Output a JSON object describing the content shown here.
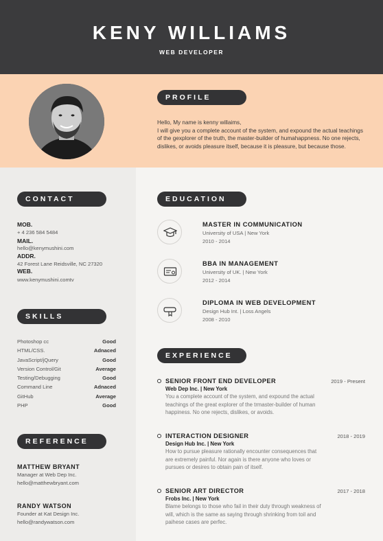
{
  "header": {
    "name": "KENY WILLIAMS",
    "role": "WEB DEVELOPER"
  },
  "profile": {
    "heading": "PROFILE",
    "greeting": "Hello, My name is kenny willaims,",
    "body": "I will give you a complete account of the system, and expound the actual teachings of the gexplorer of the truth, the master-builder of humahappness. No one rejects, dislikes, or avoids pleasure itself, because it is pleasure, but because those."
  },
  "contact": {
    "heading": "CONTACT",
    "mob_label": "MOB.",
    "mob": "+ 4 236 584 5484",
    "mail_label": "MAIL.",
    "mail": "hello@kenymushini.com",
    "addr_label": "ADDR.",
    "addr": "42 Forest Lane Reidsville, NC 27320",
    "web_label": "WEB.",
    "web": "www.kenymushini.comtv"
  },
  "skills": {
    "heading": "SKILLS",
    "items": [
      {
        "name": "Photoshop cc",
        "level": "Good"
      },
      {
        "name": "HTML/CSS.",
        "level": "Adnaced"
      },
      {
        "name": "JavaScript/jQuery",
        "level": "Good"
      },
      {
        "name": "Version Control/Git",
        "level": "Average"
      },
      {
        "name": "Testing/Debugging",
        "level": "Good"
      },
      {
        "name": "Command Line",
        "level": "Adnaced"
      },
      {
        "name": "GitHub",
        "level": "Average"
      },
      {
        "name": "PHP",
        "level": "Good"
      }
    ]
  },
  "reference": {
    "heading": "REFERENCE",
    "items": [
      {
        "name": "MATTHEW BRYANT",
        "title": "Manager at Web Dep Inc.",
        "email": "hello@matthewbryant.com"
      },
      {
        "name": "RANDY WATSON",
        "title": "Founder at Kat Design Inc.",
        "email": "hello@randywatson.com"
      }
    ]
  },
  "education": {
    "heading": "EDUCATION",
    "items": [
      {
        "icon": "graduation-cap-icon",
        "title": "MASTER IN COMMUNICATION",
        "school": "University of USA | New York",
        "years": "2010 - 2014"
      },
      {
        "icon": "certificate-icon",
        "title": "BBA IN MANAGEMENT",
        "school": "University of UK. | New York",
        "years": "2012 - 2014"
      },
      {
        "icon": "diploma-scroll-icon",
        "title": "DIPLOMA IN WEB DEVELOPMENT",
        "school": "Design Hub Int. | Loss Angels",
        "years": "2008 - 2010"
      }
    ]
  },
  "experience": {
    "heading": "EXPERIENCE",
    "items": [
      {
        "title": "SENIOR FRONT END DEVELOPER",
        "dates": "2019 - Present",
        "company": "Web Dep Inc. | New York",
        "desc": "You a complete account of the system, and expound the actual teachings of the great explorer of the trmaster-builder of human happiness. No one rejects, dislikes, or avoids."
      },
      {
        "title": "INTERACTION DESIGNER",
        "dates": "2018 - 2019",
        "company": "Design Hub Inc. | New York",
        "desc": "How to pursue pleasure rationally encounter consequences that are extremely painful. Nor again is there anyone who loves or pursues or desires to obtain pain of itself."
      },
      {
        "title": "SENIOR ART DIRECTOR",
        "dates": "2017 - 2018",
        "company": "Frobs Inc. | New York",
        "desc": "Blame belongs to those who fail in their duty through weakness of will, which is the same as saying through shrinking from toil and paihese cases are perfec."
      }
    ]
  },
  "colors": {
    "dark": "#3b3b3d",
    "peach": "#fbd3b3",
    "left_bg": "#edecea",
    "right_bg": "#f5f4f2"
  }
}
